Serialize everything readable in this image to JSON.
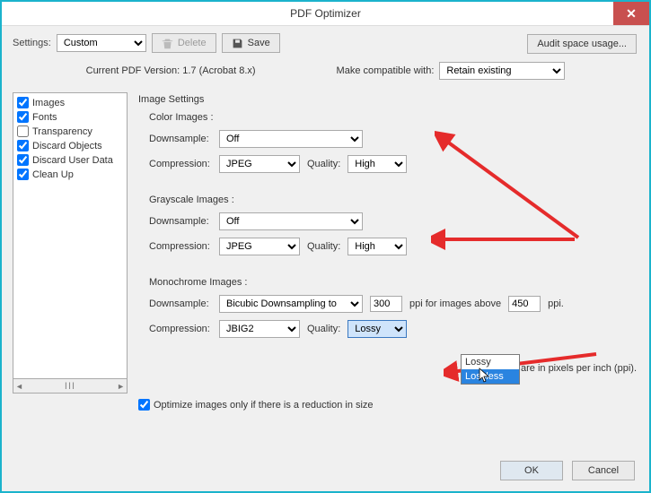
{
  "title": "PDF Optimizer",
  "close_glyph": "✕",
  "settings": {
    "label": "Settings:",
    "value": "Custom",
    "delete": "Delete",
    "save": "Save"
  },
  "audit_btn": "Audit space usage...",
  "version": {
    "current": "Current PDF Version: 1.7 (Acrobat 8.x)",
    "compat_label": "Make compatible with:",
    "compat_value": "Retain existing"
  },
  "categories": [
    {
      "label": "Images",
      "checked": true
    },
    {
      "label": "Fonts",
      "checked": true
    },
    {
      "label": "Transparency",
      "checked": false
    },
    {
      "label": "Discard Objects",
      "checked": true
    },
    {
      "label": "Discard User Data",
      "checked": true
    },
    {
      "label": "Clean Up",
      "checked": true
    }
  ],
  "scroll_thumb": "III",
  "panel": {
    "title": "Image Settings",
    "color": {
      "header": "Color Images :",
      "downsample_label": "Downsample:",
      "downsample_value": "Off",
      "compression_label": "Compression:",
      "compression_value": "JPEG",
      "quality_label": "Quality:",
      "quality_value": "High"
    },
    "gray": {
      "header": "Grayscale Images :",
      "downsample_label": "Downsample:",
      "downsample_value": "Off",
      "compression_label": "Compression:",
      "compression_value": "JPEG",
      "quality_label": "Quality:",
      "quality_value": "High"
    },
    "mono": {
      "header": "Monochrome Images :",
      "downsample_label": "Downsample:",
      "downsample_value": "Bicubic Downsampling to",
      "px_value": "300",
      "above_label": "ppi for images above",
      "above_value": "450",
      "ppi": "ppi.",
      "compression_label": "Compression:",
      "compression_value": "JBIG2",
      "quality_label": "Quality:",
      "quality_value": "Lossy",
      "options": [
        "Lossy",
        "Lossless"
      ]
    },
    "units": "All units are in pixels per inch (ppi)."
  },
  "optimize_checkbox": "Optimize images only if there is a reduction in size",
  "buttons": {
    "ok": "OK",
    "cancel": "Cancel"
  }
}
